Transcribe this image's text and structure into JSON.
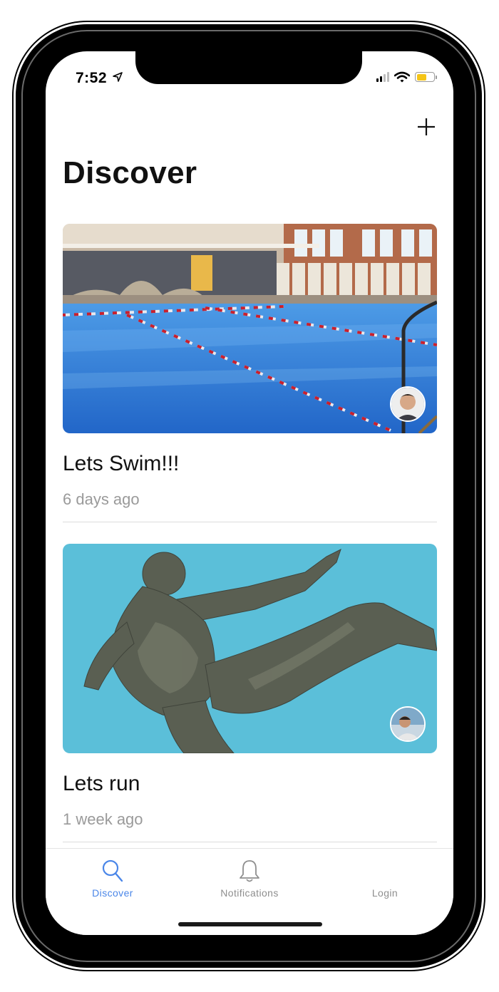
{
  "status_bar": {
    "time": "7:52",
    "location_icon": "location-arrow-icon",
    "signal_icon": "cellular-signal-icon",
    "wifi_icon": "wifi-icon",
    "battery_icon": "battery-icon",
    "battery_level": 0.6,
    "battery_color": "#f5c518"
  },
  "header": {
    "add_icon": "plus-icon",
    "title": "Discover"
  },
  "feed": {
    "items": [
      {
        "title": "Lets Swim!!!",
        "time": "6 days ago",
        "image": "swimming-pool-photo",
        "avatar": "user-avatar"
      },
      {
        "title": "Lets run",
        "time": "1 week ago",
        "image": "running-statue-photo",
        "image_background": "#5bbfd9",
        "avatar": "user-avatar"
      }
    ]
  },
  "tab_bar": {
    "active_color": "#4a86e8",
    "inactive_color": "#8e8e8e",
    "tabs": [
      {
        "label": "Discover",
        "icon": "search-icon",
        "active": true
      },
      {
        "label": "Notifications",
        "icon": "bell-icon",
        "active": false
      },
      {
        "label": "Login",
        "icon": "",
        "active": false
      }
    ]
  }
}
